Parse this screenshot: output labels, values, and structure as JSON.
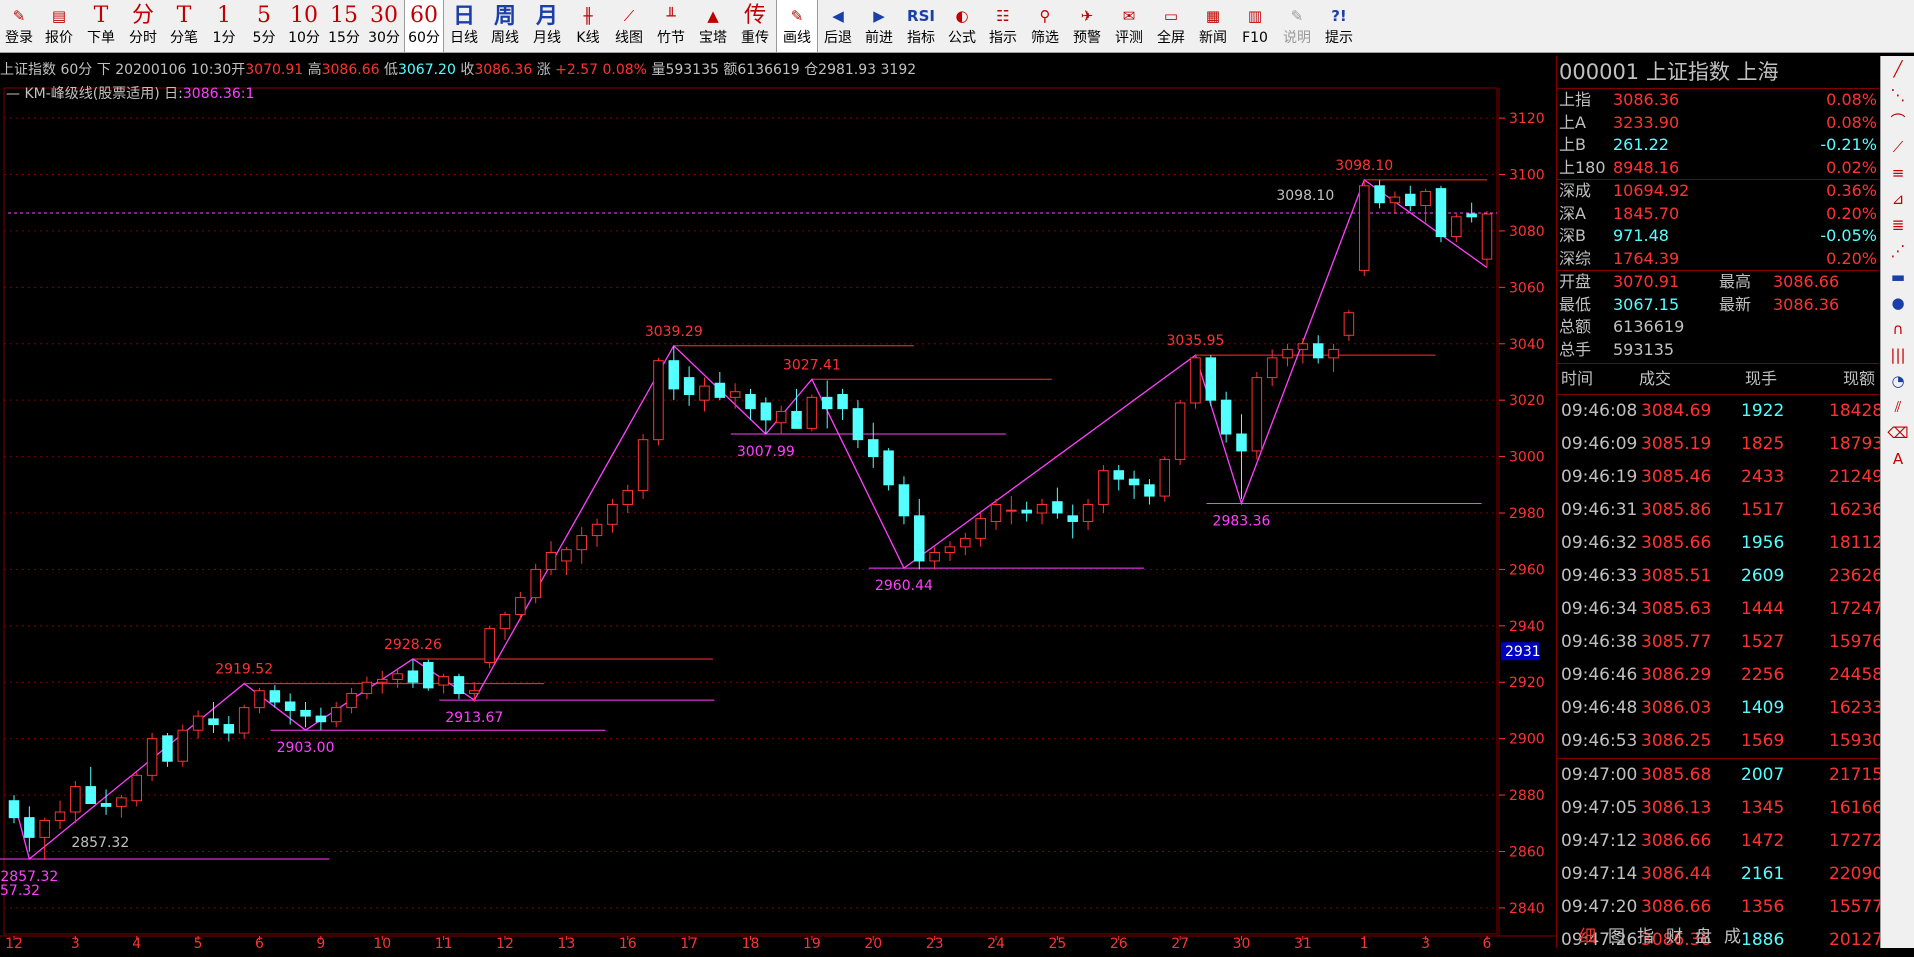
{
  "toolbar": [
    {
      "name": "login",
      "icon": "✎",
      "label": "登录",
      "style": "sm"
    },
    {
      "name": "quote",
      "icon": "▤",
      "label": "报价",
      "style": "sm"
    },
    {
      "name": "order",
      "icon": "T",
      "label": "下单"
    },
    {
      "name": "timeshare",
      "icon": "分",
      "label": "分时"
    },
    {
      "name": "tick",
      "icon": "T",
      "label": "分笔"
    },
    {
      "name": "1min",
      "icon": "1",
      "label": "1分"
    },
    {
      "name": "5min",
      "icon": "5",
      "label": "5分"
    },
    {
      "name": "10min",
      "icon": "10",
      "label": "10分"
    },
    {
      "name": "15min",
      "icon": "15",
      "label": "15分"
    },
    {
      "name": "30min",
      "icon": "30",
      "label": "30分"
    },
    {
      "name": "60min",
      "icon": "60",
      "label": "60分",
      "active": true
    },
    {
      "name": "day",
      "icon": "日",
      "label": "日线",
      "style": "blue"
    },
    {
      "name": "week",
      "icon": "周",
      "label": "周线",
      "style": "blue"
    },
    {
      "name": "month",
      "icon": "月",
      "label": "月线",
      "style": "blue"
    },
    {
      "name": "kline",
      "icon": "╫",
      "label": "K线",
      "style": "sm"
    },
    {
      "name": "line",
      "icon": "⟋",
      "label": "线图",
      "style": "sm"
    },
    {
      "name": "bamboo",
      "icon": "╨",
      "label": "竹节",
      "style": "sm"
    },
    {
      "name": "tower",
      "icon": "▲",
      "label": "宝塔",
      "style": "sm"
    },
    {
      "name": "reweight",
      "icon": "传",
      "label": "重传"
    },
    {
      "name": "draw",
      "icon": "✎",
      "label": "画线",
      "style": "sm",
      "active": true
    },
    {
      "name": "back",
      "icon": "◀",
      "label": "后退",
      "style": "sm blue"
    },
    {
      "name": "forward",
      "icon": "▶",
      "label": "前进",
      "style": "sm blue"
    },
    {
      "name": "indicator",
      "icon": "RSI",
      "label": "指标",
      "style": "sm blue"
    },
    {
      "name": "formula",
      "icon": "◐",
      "label": "公式",
      "style": "sm"
    },
    {
      "name": "signal",
      "icon": "☷",
      "label": "指示",
      "style": "sm"
    },
    {
      "name": "filter",
      "icon": "⚲",
      "label": "筛选",
      "style": "sm"
    },
    {
      "name": "alert",
      "icon": "✈",
      "label": "预警",
      "style": "sm"
    },
    {
      "name": "rate",
      "icon": "✉",
      "label": "评测",
      "style": "sm"
    },
    {
      "name": "fullscreen",
      "icon": "▭",
      "label": "全屏",
      "style": "sm"
    },
    {
      "name": "news",
      "icon": "▦",
      "label": "新闻",
      "style": "sm"
    },
    {
      "name": "f10",
      "icon": "▥",
      "label": "F10",
      "style": "sm"
    },
    {
      "name": "help-doc",
      "icon": "✎",
      "label": "说明",
      "style": "sm",
      "disabled": true
    },
    {
      "name": "hint",
      "icon": "?!",
      "label": "提示",
      "style": "sm blue"
    }
  ],
  "infobar": {
    "name": "上证指数",
    "period": "60分",
    "dir": "下",
    "date": "20200106 10:30",
    "open_label": "开",
    "open": "3070.91",
    "high_label": "高",
    "high": "3086.66",
    "low_label": "低",
    "low": "3067.20",
    "close_label": "收",
    "close": "3086.36",
    "chg_label": "涨",
    "chg": "+2.57",
    "pct": "0.08%",
    "vol_label": "量",
    "vol": "593135",
    "amt_label": "额",
    "amt": "6136619",
    "oi_label": "仓",
    "oi": "2981.93",
    "extra": "3192"
  },
  "indicator": {
    "name": "KM-峰级线(股票适用)",
    "period": "日",
    "value": "3086.36",
    "suffix": ":1"
  },
  "chart_data": {
    "type": "candlestick",
    "ylim": [
      2835,
      3125
    ],
    "y_ticks": [
      2840,
      2860,
      2880,
      2900,
      2920,
      2940,
      2960,
      2980,
      3000,
      3020,
      3040,
      3060,
      3080,
      3100,
      3120
    ],
    "x_ticks": [
      {
        "i": 0,
        "label": "12"
      },
      {
        "i": 2,
        "label": "3"
      },
      {
        "i": 4,
        "label": "4"
      },
      {
        "i": 6,
        "label": "5"
      },
      {
        "i": 8,
        "label": "6"
      },
      {
        "i": 10,
        "label": "9"
      },
      {
        "i": 12,
        "label": "10"
      },
      {
        "i": 14,
        "label": "11"
      },
      {
        "i": 16,
        "label": "12"
      },
      {
        "i": 18,
        "label": "13"
      },
      {
        "i": 20,
        "label": "16"
      },
      {
        "i": 22,
        "label": "17"
      },
      {
        "i": 24,
        "label": "18"
      },
      {
        "i": 26,
        "label": "19"
      },
      {
        "i": 28,
        "label": "20"
      },
      {
        "i": 30,
        "label": "23"
      },
      {
        "i": 32,
        "label": "24"
      },
      {
        "i": 34,
        "label": "25"
      },
      {
        "i": 36,
        "label": "26"
      },
      {
        "i": 38,
        "label": "27"
      },
      {
        "i": 40,
        "label": "30"
      },
      {
        "i": 42,
        "label": "31"
      },
      {
        "i": 44,
        "label": "1"
      },
      {
        "i": 46,
        "label": "3"
      },
      {
        "i": 48,
        "label": "6"
      }
    ],
    "cursor_price": "2931",
    "ref_price": 3086.36,
    "candles": [
      {
        "o": 2878,
        "h": 2880,
        "l": 2870,
        "c": 2872
      },
      {
        "o": 2872,
        "h": 2876,
        "l": 2860,
        "c": 2865
      },
      {
        "o": 2865,
        "h": 2872,
        "l": 2857,
        "c": 2871
      },
      {
        "o": 2871,
        "h": 2878,
        "l": 2868,
        "c": 2874
      },
      {
        "o": 2874,
        "h": 2885,
        "l": 2870,
        "c": 2883
      },
      {
        "o": 2883,
        "h": 2890,
        "l": 2877,
        "c": 2877
      },
      {
        "o": 2877,
        "h": 2882,
        "l": 2873,
        "c": 2876
      },
      {
        "o": 2876,
        "h": 2880,
        "l": 2872,
        "c": 2879
      },
      {
        "o": 2878,
        "h": 2888,
        "l": 2876,
        "c": 2887
      },
      {
        "o": 2887,
        "h": 2902,
        "l": 2885,
        "c": 2900
      },
      {
        "o": 2901,
        "h": 2902,
        "l": 2890,
        "c": 2892
      },
      {
        "o": 2892,
        "h": 2905,
        "l": 2890,
        "c": 2903
      },
      {
        "o": 2903,
        "h": 2910,
        "l": 2900,
        "c": 2908
      },
      {
        "o": 2907,
        "h": 2913,
        "l": 2902,
        "c": 2905
      },
      {
        "o": 2905,
        "h": 2908,
        "l": 2899,
        "c": 2902
      },
      {
        "o": 2902,
        "h": 2912,
        "l": 2900,
        "c": 2911
      },
      {
        "o": 2911,
        "h": 2918,
        "l": 2909,
        "c": 2917
      },
      {
        "o": 2917,
        "h": 2919,
        "l": 2911,
        "c": 2913
      },
      {
        "o": 2913,
        "h": 2916,
        "l": 2905,
        "c": 2910
      },
      {
        "o": 2910,
        "h": 2913,
        "l": 2904,
        "c": 2908
      },
      {
        "o": 2908,
        "h": 2911,
        "l": 2903,
        "c": 2906
      },
      {
        "o": 2906,
        "h": 2913,
        "l": 2904,
        "c": 2911
      },
      {
        "o": 2911,
        "h": 2918,
        "l": 2909,
        "c": 2916
      },
      {
        "o": 2916,
        "h": 2922,
        "l": 2914,
        "c": 2920
      },
      {
        "o": 2920,
        "h": 2924,
        "l": 2916,
        "c": 2921
      },
      {
        "o": 2921,
        "h": 2925,
        "l": 2918,
        "c": 2923
      },
      {
        "o": 2924,
        "h": 2928,
        "l": 2918,
        "c": 2920
      },
      {
        "o": 2927,
        "h": 2928,
        "l": 2917,
        "c": 2918
      },
      {
        "o": 2919,
        "h": 2923,
        "l": 2916,
        "c": 2922
      },
      {
        "o": 2922,
        "h": 2923,
        "l": 2914,
        "c": 2916
      },
      {
        "o": 2916,
        "h": 2920,
        "l": 2913,
        "c": 2917
      },
      {
        "o": 2927,
        "h": 2940,
        "l": 2925,
        "c": 2939
      },
      {
        "o": 2939,
        "h": 2945,
        "l": 2935,
        "c": 2944
      },
      {
        "o": 2944,
        "h": 2952,
        "l": 2942,
        "c": 2950
      },
      {
        "o": 2950,
        "h": 2962,
        "l": 2948,
        "c": 2960
      },
      {
        "o": 2960,
        "h": 2970,
        "l": 2958,
        "c": 2966
      },
      {
        "o": 2963,
        "h": 2968,
        "l": 2958,
        "c": 2967
      },
      {
        "o": 2967,
        "h": 2975,
        "l": 2962,
        "c": 2972
      },
      {
        "o": 2972,
        "h": 2978,
        "l": 2968,
        "c": 2976
      },
      {
        "o": 2976,
        "h": 2985,
        "l": 2973,
        "c": 2983
      },
      {
        "o": 2983,
        "h": 2990,
        "l": 2980,
        "c": 2988
      },
      {
        "o": 2988,
        "h": 3008,
        "l": 2985,
        "c": 3006
      },
      {
        "o": 3006,
        "h": 3035,
        "l": 3004,
        "c": 3034
      },
      {
        "o": 3034,
        "h": 3039,
        "l": 3020,
        "c": 3024
      },
      {
        "o": 3028,
        "h": 3032,
        "l": 3018,
        "c": 3022
      },
      {
        "o": 3020,
        "h": 3028,
        "l": 3016,
        "c": 3025
      },
      {
        "o": 3026,
        "h": 3030,
        "l": 3020,
        "c": 3021
      },
      {
        "o": 3021,
        "h": 3026,
        "l": 3017,
        "c": 3023
      },
      {
        "o": 3022,
        "h": 3024,
        "l": 3013,
        "c": 3017
      },
      {
        "o": 3019,
        "h": 3021,
        "l": 3008,
        "c": 3013
      },
      {
        "o": 3012,
        "h": 3018,
        "l": 3008,
        "c": 3016
      },
      {
        "o": 3016,
        "h": 3024,
        "l": 3012,
        "c": 3010
      },
      {
        "o": 3010,
        "h": 3022,
        "l": 3009,
        "c": 3021
      },
      {
        "o": 3021,
        "h": 3027,
        "l": 3010,
        "c": 3017
      },
      {
        "o": 3022,
        "h": 3024,
        "l": 3013,
        "c": 3017
      },
      {
        "o": 3017,
        "h": 3020,
        "l": 3003,
        "c": 3006
      },
      {
        "o": 3006,
        "h": 3012,
        "l": 2996,
        "c": 3000
      },
      {
        "o": 3002,
        "h": 3003,
        "l": 2988,
        "c": 2990
      },
      {
        "o": 2990,
        "h": 2993,
        "l": 2976,
        "c": 2979
      },
      {
        "o": 2979,
        "h": 2985,
        "l": 2960,
        "c": 2963
      },
      {
        "o": 2963,
        "h": 2968,
        "l": 2960,
        "c": 2966
      },
      {
        "o": 2966,
        "h": 2970,
        "l": 2963,
        "c": 2968
      },
      {
        "o": 2968,
        "h": 2973,
        "l": 2965,
        "c": 2971
      },
      {
        "o": 2971,
        "h": 2980,
        "l": 2968,
        "c": 2978
      },
      {
        "o": 2977,
        "h": 2985,
        "l": 2974,
        "c": 2983
      },
      {
        "o": 2981,
        "h": 2986,
        "l": 2976,
        "c": 2981
      },
      {
        "o": 2981,
        "h": 2984,
        "l": 2977,
        "c": 2980
      },
      {
        "o": 2980,
        "h": 2985,
        "l": 2976,
        "c": 2983
      },
      {
        "o": 2984,
        "h": 2989,
        "l": 2978,
        "c": 2980
      },
      {
        "o": 2979,
        "h": 2983,
        "l": 2971,
        "c": 2977
      },
      {
        "o": 2977,
        "h": 2985,
        "l": 2974,
        "c": 2983
      },
      {
        "o": 2983,
        "h": 2997,
        "l": 2980,
        "c": 2995
      },
      {
        "o": 2995,
        "h": 2997,
        "l": 2988,
        "c": 2992
      },
      {
        "o": 2992,
        "h": 2995,
        "l": 2985,
        "c": 2990
      },
      {
        "o": 2990,
        "h": 2992,
        "l": 2983,
        "c": 2986
      },
      {
        "o": 2986,
        "h": 3000,
        "l": 2984,
        "c": 2999
      },
      {
        "o": 2999,
        "h": 3020,
        "l": 2997,
        "c": 3019
      },
      {
        "o": 3019,
        "h": 3036,
        "l": 3017,
        "c": 3035
      },
      {
        "o": 3035,
        "h": 3036,
        "l": 3018,
        "c": 3020
      },
      {
        "o": 3020,
        "h": 3023,
        "l": 3005,
        "c": 3008
      },
      {
        "o": 3008,
        "h": 3015,
        "l": 2985,
        "c": 3002
      },
      {
        "o": 3002,
        "h": 3030,
        "l": 2999,
        "c": 3028
      },
      {
        "o": 3028,
        "h": 3038,
        "l": 3025,
        "c": 3035
      },
      {
        "o": 3035,
        "h": 3040,
        "l": 3032,
        "c": 3038
      },
      {
        "o": 3038,
        "h": 3042,
        "l": 3033,
        "c": 3040
      },
      {
        "o": 3040,
        "h": 3043,
        "l": 3033,
        "c": 3035
      },
      {
        "o": 3035,
        "h": 3040,
        "l": 3030,
        "c": 3038
      },
      {
        "o": 3043,
        "h": 3052,
        "l": 3041,
        "c": 3051
      },
      {
        "o": 3066,
        "h": 3098,
        "l": 3064,
        "c": 3096
      },
      {
        "o": 3096,
        "h": 3098,
        "l": 3088,
        "c": 3090
      },
      {
        "o": 3090,
        "h": 3094,
        "l": 3086,
        "c": 3092
      },
      {
        "o": 3093,
        "h": 3096,
        "l": 3087,
        "c": 3089
      },
      {
        "o": 3089,
        "h": 3095,
        "l": 3083,
        "c": 3094
      },
      {
        "o": 3095,
        "h": 3096,
        "l": 3076,
        "c": 3078
      },
      {
        "o": 3078,
        "h": 3086,
        "l": 3076,
        "c": 3085
      },
      {
        "o": 3086,
        "h": 3090,
        "l": 3083,
        "c": 3085
      },
      {
        "o": 3070,
        "h": 3087,
        "l": 3067,
        "c": 3086
      }
    ],
    "peaks": [
      {
        "i": 1,
        "price": 2857.32,
        "label": "2857.32",
        "labelAlt": "57.32",
        "type": "low"
      },
      {
        "i": 15,
        "price": 2919.52,
        "label": "2919.52",
        "type": "high"
      },
      {
        "i": 19,
        "price": 2903.0,
        "label": "2903.00",
        "type": "low"
      },
      {
        "i": 26,
        "price": 2928.26,
        "label": "2928.26",
        "type": "high"
      },
      {
        "i": 30,
        "price": 2913.67,
        "label": "2913.67",
        "type": "low"
      },
      {
        "i": 43,
        "price": 3039.29,
        "label": "3039.29",
        "type": "high"
      },
      {
        "i": 49,
        "price": 3007.99,
        "label": "3007.99",
        "type": "low"
      },
      {
        "i": 52,
        "price": 3027.41,
        "label": "3027.41",
        "type": "high"
      },
      {
        "i": 58,
        "price": 2960.44,
        "label": "2960.44",
        "type": "low"
      },
      {
        "i": 77,
        "price": 3035.95,
        "label": "3035.95",
        "type": "high"
      },
      {
        "i": 80,
        "price": 2983.36,
        "label": "2983.36",
        "type": "low"
      },
      {
        "i": 88,
        "price": 3098.1,
        "label": "3098.10",
        "labelAlt": "3098.10",
        "type": "high"
      }
    ]
  },
  "right_panel": {
    "title": "000001  上证指数   上海",
    "indices": [
      {
        "name": "上指",
        "value": "3086.36",
        "pct": "0.08%",
        "up": true
      },
      {
        "name": "上A",
        "value": "3233.90",
        "pct": "0.08%",
        "up": true
      },
      {
        "name": "上B",
        "value": "261.22",
        "pct": "-0.21%",
        "up": false
      },
      {
        "name": "上180",
        "value": "8948.16",
        "pct": "0.02%",
        "up": true
      },
      {
        "name": "深成",
        "value": "10694.92",
        "pct": "0.36%",
        "up": true
      },
      {
        "name": "深A",
        "value": "1845.70",
        "pct": "0.20%",
        "up": true
      },
      {
        "name": "深B",
        "value": "971.48",
        "pct": "-0.05%",
        "up": false
      },
      {
        "name": "深综",
        "value": "1764.39",
        "pct": "0.20%",
        "up": true
      }
    ],
    "quote": {
      "open_label": "开盘",
      "open": "3070.91",
      "high_label": "最高",
      "high": "3086.66",
      "low_label": "最低",
      "low": "3067.15",
      "last_label": "最新",
      "last": "3086.36",
      "amount_label": "总额",
      "amount": "6136619",
      "hands_label": "总手",
      "hands": "593135"
    },
    "tick_headers": {
      "time": "时间",
      "price": "成交",
      "vol": "现手",
      "amount": "现额"
    },
    "ticks": [
      {
        "t": "09:46:08",
        "p": "3084.69",
        "v": "1922",
        "a": "18428",
        "vc": "C"
      },
      {
        "t": "09:46:09",
        "p": "3085.19",
        "v": "1825",
        "a": "18793",
        "vc": "R"
      },
      {
        "t": "09:46:19",
        "p": "3085.46",
        "v": "2433",
        "a": "21249",
        "vc": "R"
      },
      {
        "t": "09:46:31",
        "p": "3085.86",
        "v": "1517",
        "a": "16236",
        "vc": "R"
      },
      {
        "t": "09:46:32",
        "p": "3085.66",
        "v": "1956",
        "a": "18112",
        "vc": "C"
      },
      {
        "t": "09:46:33",
        "p": "3085.51",
        "v": "2609",
        "a": "23626",
        "vc": "C"
      },
      {
        "t": "09:46:34",
        "p": "3085.63",
        "v": "1444",
        "a": "17247",
        "vc": "R"
      },
      {
        "t": "09:46:38",
        "p": "3085.77",
        "v": "1527",
        "a": "15976",
        "vc": "R"
      },
      {
        "t": "09:46:46",
        "p": "3086.29",
        "v": "2256",
        "a": "24458",
        "vc": "R"
      },
      {
        "t": "09:46:48",
        "p": "3086.03",
        "v": "1409",
        "a": "16233",
        "vc": "C"
      },
      {
        "t": "09:46:53",
        "p": "3086.25",
        "v": "1569",
        "a": "15930",
        "vc": "R"
      },
      {
        "t": "09:47:00",
        "p": "3085.68",
        "v": "2007",
        "a": "21715",
        "vc": "C"
      },
      {
        "t": "09:47:05",
        "p": "3086.13",
        "v": "1345",
        "a": "16166",
        "vc": "R"
      },
      {
        "t": "09:47:12",
        "p": "3086.66",
        "v": "1472",
        "a": "17272",
        "vc": "R"
      },
      {
        "t": "09:47:14",
        "p": "3086.44",
        "v": "2161",
        "a": "22090",
        "vc": "C"
      },
      {
        "t": "09:47:20",
        "p": "3086.66",
        "v": "1356",
        "a": "15577",
        "vc": "R"
      },
      {
        "t": "09:47:26",
        "p": "3086.36",
        "v": "1886",
        "a": "20127",
        "vc": "C"
      }
    ],
    "tabs": [
      "细",
      "图",
      "指",
      "财",
      "盘",
      "成"
    ]
  },
  "colors": {
    "up": "#ff3232",
    "down": "#54ffff",
    "magenta": "#ff40ff",
    "grid": "#800000",
    "axis": "#c0c0c0"
  }
}
